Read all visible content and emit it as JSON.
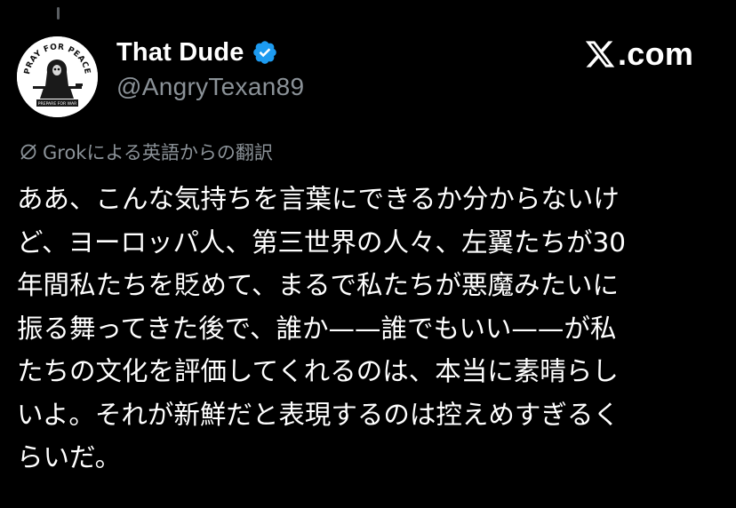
{
  "author": {
    "display_name": "That Dude",
    "handle": "@AngryTexan89",
    "verified": true,
    "avatar_text_top": "PRAY FOR PEACE",
    "avatar_text_bottom": "PREPARE FOR WAR"
  },
  "brand": {
    "name": "X.com",
    "icon": "x-logo-icon",
    "suffix": ".com"
  },
  "translation": {
    "icon": "grok-icon",
    "label": "Grokによる英語からの翻訳"
  },
  "tweet": {
    "lines": [
      "ああ、こんな気持ちを言葉にできるか分からないけ",
      "ど、ヨーロッパ人、第三世界の人々、左翼たちが30",
      "年間私たちを貶めて、まるで私たちが悪魔みたいに",
      "振る舞ってきた後で、誰か——誰でもいい——が私",
      "たちの文化を評価してくれるのは、本当に素晴らし",
      "いよ。それが新鮮だと表現するのは控えめすぎるく",
      "らいだ。"
    ]
  },
  "colors": {
    "background": "#000000",
    "text_primary": "#ffffff",
    "text_secondary": "#8b9298",
    "verified_blue": "#1d9bf0"
  }
}
